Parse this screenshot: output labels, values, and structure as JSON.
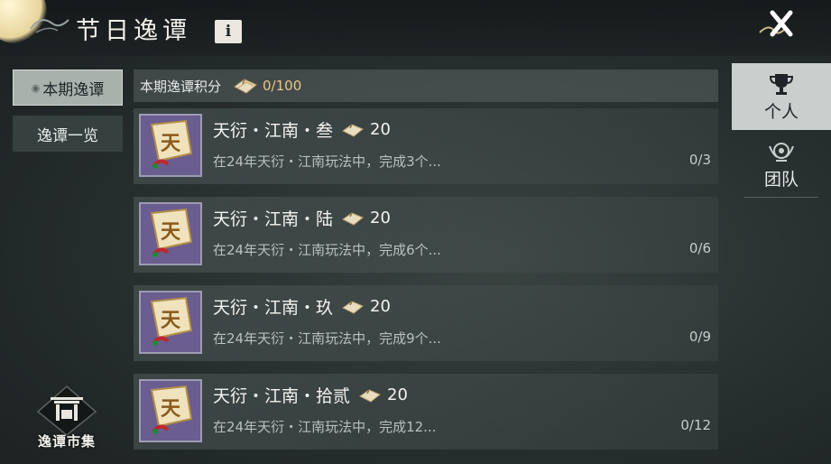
{
  "header": {
    "title": "节日逸谭",
    "info_label": "i"
  },
  "left_tabs": [
    {
      "label": "本期逸谭",
      "active": true
    },
    {
      "label": "逸谭一览",
      "active": false
    }
  ],
  "market": {
    "label": "逸谭市集"
  },
  "score": {
    "label": "本期逸谭积分",
    "value": "0/100"
  },
  "tasks": [
    {
      "name": "天衍・江南・叁",
      "points": "20",
      "desc": "在24年天衍・江南玩法中，完成3个...",
      "progress": "0/3"
    },
    {
      "name": "天衍・江南・陆",
      "points": "20",
      "desc": "在24年天衍・江南玩法中，完成6个...",
      "progress": "0/6"
    },
    {
      "name": "天衍・江南・玖",
      "points": "20",
      "desc": "在24年天衍・江南玩法中，完成9个...",
      "progress": "0/9"
    },
    {
      "name": "天衍・江南・拾贰",
      "points": "20",
      "desc": "在24年天衍・江南玩法中，完成12...",
      "progress": "0/12"
    }
  ],
  "task_icon_char": "天",
  "right_tabs": [
    {
      "label": "个人",
      "icon": "trophy-icon",
      "active": true
    },
    {
      "label": "团队",
      "icon": "team-emblem-icon",
      "active": false
    }
  ],
  "colors": {
    "accent_gold": "#e8c78c",
    "icon_purple": "#6a5d8f"
  }
}
